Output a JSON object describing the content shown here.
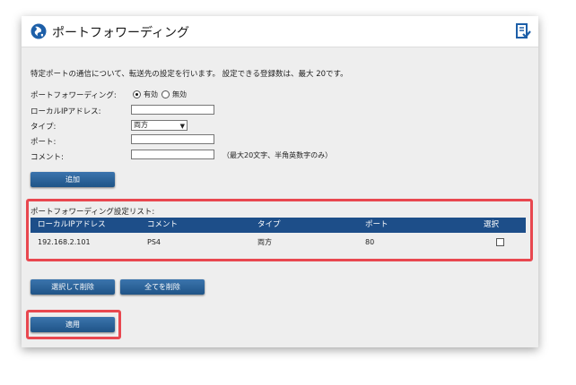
{
  "header": {
    "title": "ポートフォワーディング"
  },
  "description": "特定ポートの通信について、転送先の設定を行います。 設定できる登録数は、最大 20です。",
  "form": {
    "pf_label": "ポートフォワーディング:",
    "enabled_label": "有効",
    "disabled_label": "無効",
    "enabled_selected": true,
    "local_ip_label": "ローカルIPアドレス:",
    "type_label": "タイプ:",
    "type_value": "両方",
    "port_label": "ポート:",
    "comment_label": "コメント:",
    "comment_hint": "（最大20文字、半角英数字のみ）",
    "local_ip_value": "",
    "port_value": "",
    "comment_value": ""
  },
  "buttons": {
    "add": "追加",
    "delete_selected": "選択して削除",
    "delete_all": "全てを削除",
    "apply": "適用"
  },
  "list": {
    "title": "ポートフォワーディング設定リスト:",
    "columns": [
      "ローカルIPアドレス",
      "コメント",
      "タイプ",
      "ポート",
      "選択"
    ],
    "rows": [
      {
        "ip": "192.168.2.101",
        "comment": "PS4",
        "type": "両方",
        "port": "80",
        "selected": false
      }
    ]
  },
  "colors": {
    "header_bar": "#1d4e89",
    "button": "#2a63a0",
    "highlight": "#e8474f",
    "panel_bg": "#eeeeee"
  }
}
